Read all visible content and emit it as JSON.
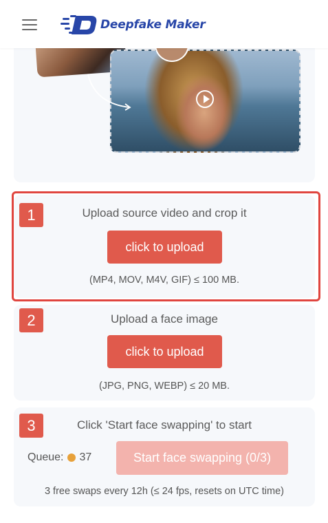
{
  "header": {
    "brand_name": "Deepfake Maker",
    "brand_color": "#2846a8",
    "menu_icon": "hamburger-menu-icon"
  },
  "hero": {
    "play_icon": "play-circle-icon",
    "arrow_icon": "curved-arrow-icon"
  },
  "steps": [
    {
      "number": "1",
      "title": "Upload source video and crop it",
      "button_label": "click to upload",
      "note": "(MP4, MOV, M4V, GIF) ≤ 100 MB."
    },
    {
      "number": "2",
      "title": "Upload a face image",
      "button_label": "click to upload",
      "note": "(JPG, PNG, WEBP) ≤ 20 MB."
    },
    {
      "number": "3",
      "title": "Click 'Start face swapping' to start",
      "queue_label": "Queue:",
      "queue_count": "37",
      "start_button_label": "Start face swapping (0/3)",
      "note": "3 free swaps every 12h (≤ 24 fps, resets on UTC time)"
    }
  ],
  "colors": {
    "accent": "#e05a4c",
    "accent_disabled": "#f3b3ad",
    "highlight_border": "#e0453f",
    "queue_dot": "#e7a13a",
    "card_bg": "#f6f8fb"
  }
}
